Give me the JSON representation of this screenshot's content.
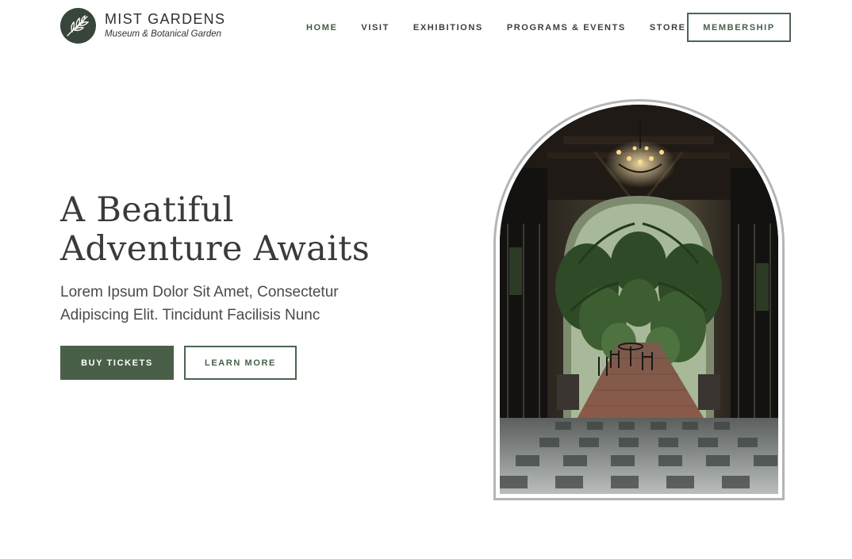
{
  "brand": {
    "name": "MIST GARDENS",
    "tagline": "Museum & Botanical Garden",
    "logo_icon": "leaf-branch-icon",
    "color": "#37453a"
  },
  "nav": {
    "items": [
      {
        "label": "HOME",
        "active": true
      },
      {
        "label": "VISIT",
        "active": false
      },
      {
        "label": "EXHIBITIONS",
        "active": false
      },
      {
        "label": "PROGRAMS & EVENTS",
        "active": false
      },
      {
        "label": "STORE",
        "active": false
      }
    ],
    "membership_label": "MEMBERSHIP"
  },
  "hero": {
    "title_line1": "A Beatiful",
    "title_line2": "Adventure Awaits",
    "subtitle_line1": "Lorem Ipsum Dolor Sit Amet, Consectetur",
    "subtitle_line2": "Adipiscing Elit. Tincidunt Facilisis Nunc",
    "primary_button": "BUY TICKETS",
    "secondary_button": "LEARN MORE",
    "image": "arched-courtyard-garden-photo"
  },
  "colors": {
    "accent": "#4a5f48",
    "text": "#3a3a3a",
    "frame": "#b5b5b5"
  }
}
